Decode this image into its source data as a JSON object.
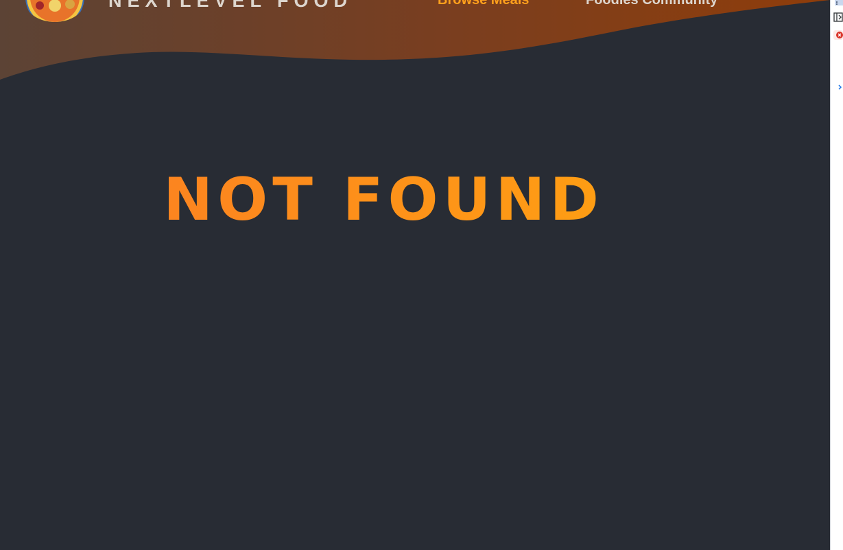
{
  "header": {
    "brand": "NEXTLEVEL FOOD",
    "nav": [
      {
        "label": "Browse Meals",
        "active": true
      },
      {
        "label": "Foodies Community",
        "active": false
      }
    ]
  },
  "main": {
    "heading": "NOT FOUND"
  },
  "colors": {
    "background": "#282c34",
    "accent": "#ffa01c",
    "header_gradient_start": "#5e4234",
    "header_gradient_end": "#8e3f0c",
    "nav_text": "#ddd6ce"
  },
  "side_panel": {
    "icons": [
      "grid-icon",
      "panel-toggle-icon",
      "error-icon",
      "chevron-right-icon"
    ]
  }
}
